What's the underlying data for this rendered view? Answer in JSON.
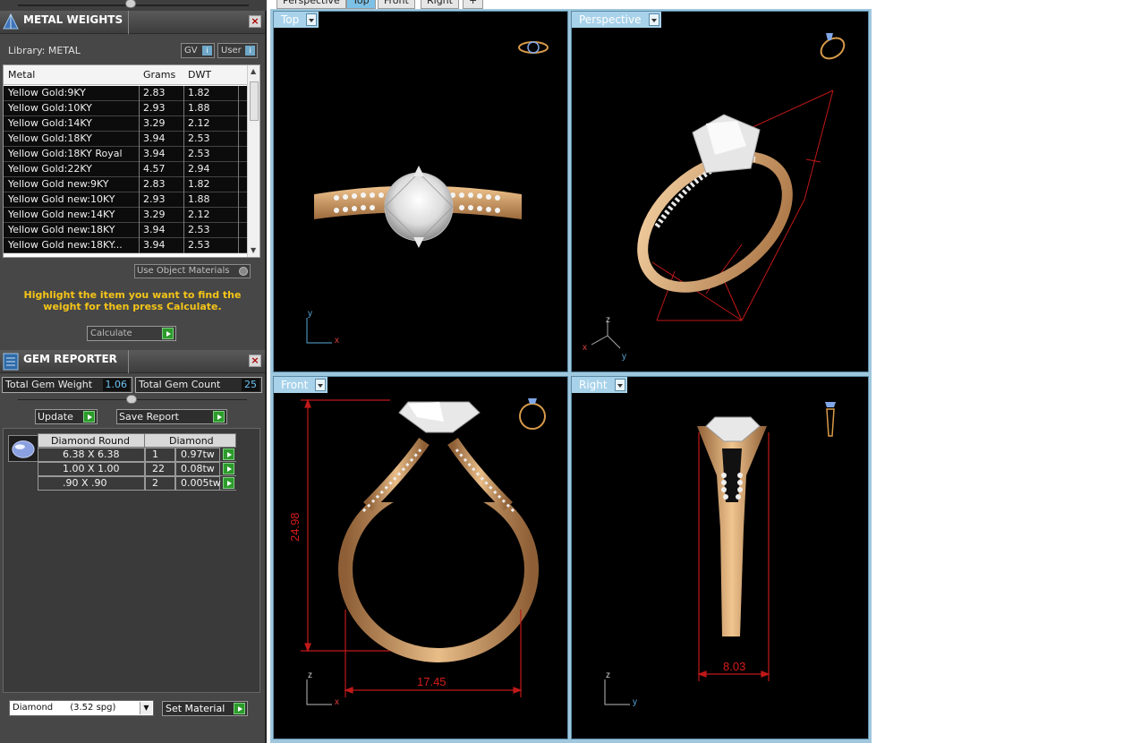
{
  "metal_weights": {
    "title": "METAL WEIGHTS",
    "library_label": "Library: METAL",
    "gv_label": "GV",
    "user_label": "User",
    "columns": [
      "Metal",
      "Grams",
      "DWT"
    ],
    "rows": [
      {
        "metal": "Yellow Gold:9KY",
        "grams": "2.83",
        "dwt": "1.82"
      },
      {
        "metal": "Yellow Gold:10KY",
        "grams": "2.93",
        "dwt": "1.88"
      },
      {
        "metal": "Yellow Gold:14KY",
        "grams": "3.29",
        "dwt": "2.12"
      },
      {
        "metal": "Yellow Gold:18KY",
        "grams": "3.94",
        "dwt": "2.53"
      },
      {
        "metal": "Yellow Gold:18KY Royal",
        "grams": "3.94",
        "dwt": "2.53"
      },
      {
        "metal": "Yellow Gold:22KY",
        "grams": "4.57",
        "dwt": "2.94"
      },
      {
        "metal": "Yellow Gold new:9KY",
        "grams": "2.83",
        "dwt": "1.82"
      },
      {
        "metal": "Yellow Gold new:10KY",
        "grams": "2.93",
        "dwt": "1.88"
      },
      {
        "metal": "Yellow Gold new:14KY",
        "grams": "3.29",
        "dwt": "2.12"
      },
      {
        "metal": "Yellow Gold new:18KY",
        "grams": "3.94",
        "dwt": "2.53"
      },
      {
        "metal": "Yellow Gold new:18KY...",
        "grams": "3.94",
        "dwt": "2.53"
      }
    ],
    "use_object_materials": "Use Object Materials",
    "hint": "Highlight the item you want to find the weight for then press Calculate.",
    "calculate_label": "Calculate"
  },
  "gem_reporter": {
    "title": "GEM REPORTER",
    "total_weight_label": "Total Gem Weight",
    "total_weight_value": "1.06",
    "total_count_label": "Total Gem Count",
    "total_count_value": "25",
    "update_label": "Update",
    "save_report_label": "Save Report",
    "col_shape": "Diamond Round",
    "col_material": "Diamond",
    "rows": [
      {
        "size": "6.38 X 6.38",
        "count": "1",
        "weight": "0.97tw"
      },
      {
        "size": "1.00 X 1.00",
        "count": "22",
        "weight": "0.08tw"
      },
      {
        "size": ".90 X .90",
        "count": "2",
        "weight": "0.005tw"
      }
    ],
    "material_select": "Diamond      (3.52 spg)",
    "set_material_label": "Set Material"
  },
  "viewport_tabs": [
    "Perspective",
    "Top",
    "Front",
    "Right"
  ],
  "viewports": {
    "top": {
      "label": "Top"
    },
    "perspective": {
      "label": "Perspective"
    },
    "front": {
      "label": "Front",
      "dim_height": "24.98",
      "dim_width": "17.45"
    },
    "right": {
      "label": "Right",
      "dim_width": "8.03"
    }
  },
  "colors": {
    "gold": "#c9935e",
    "dimension_red": "#d81b1b",
    "viewport_label": "#a8d2ea",
    "hint_yellow": "#f5c518"
  }
}
